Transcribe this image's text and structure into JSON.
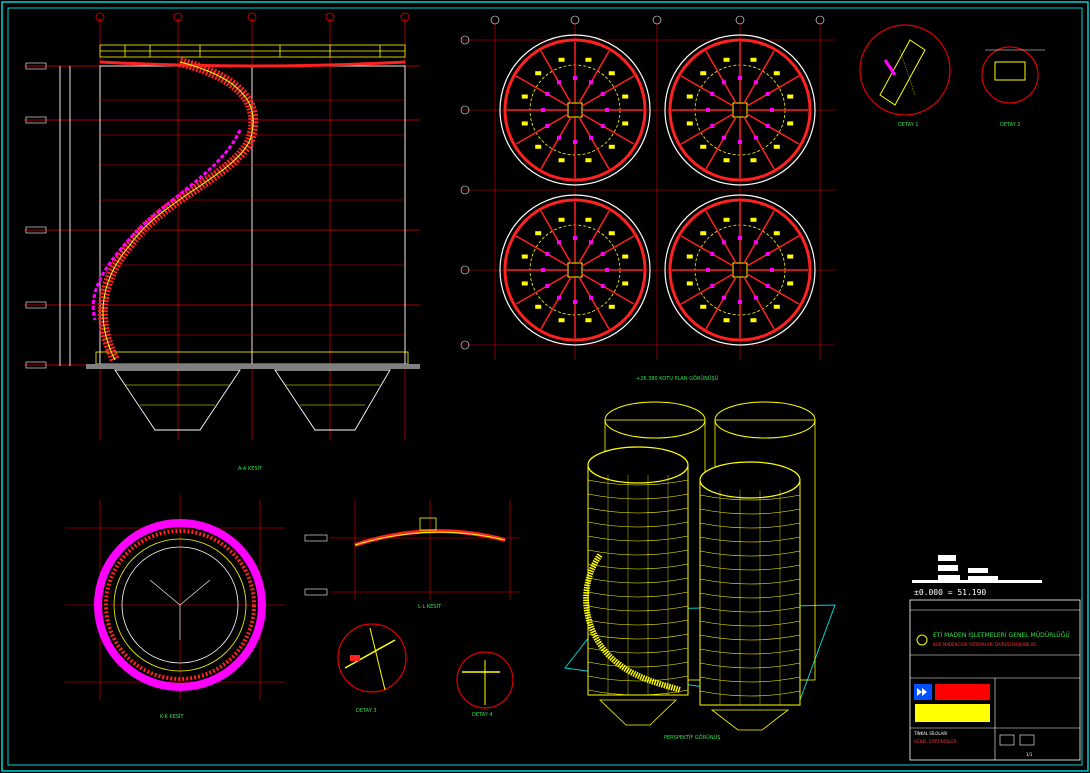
{
  "drawing": {
    "elevation_text": "±0.000 = 51.190",
    "view_labels": {
      "section_a": "A-A KESİT",
      "plan": "+26.380 KOTU PLAN GÖRÜNÜŞÜ",
      "detail_1": "DETAY 1",
      "detail_2": "DETAY 2",
      "section_k": "K-K KESİT",
      "section_l": "L-L KESİT",
      "detail_3": "DETAY 3",
      "detail_4": "DETAY 4",
      "perspective": "PERSPEKTİF GÖRÜNÜŞ"
    },
    "title_block": {
      "company": "ETİ MADEN İŞLETMELERİ GENEL MÜDÜRLÜĞÜ",
      "department": "BOR MADENCİLİK YATIRIMLARI DAİRESİ BAŞKANLIĞI",
      "project": "TİNKAL SİLOLARI",
      "subtitle": "GENEL GÖRÜNÜŞLER",
      "sheet": "1/1"
    },
    "colors": {
      "background": "#000000",
      "frame": "#00d4d4",
      "grid": "#e00000",
      "steel": "#ffff00",
      "stair": "#ff00ff",
      "text": "#2fe04a",
      "white": "#ffffff"
    }
  }
}
